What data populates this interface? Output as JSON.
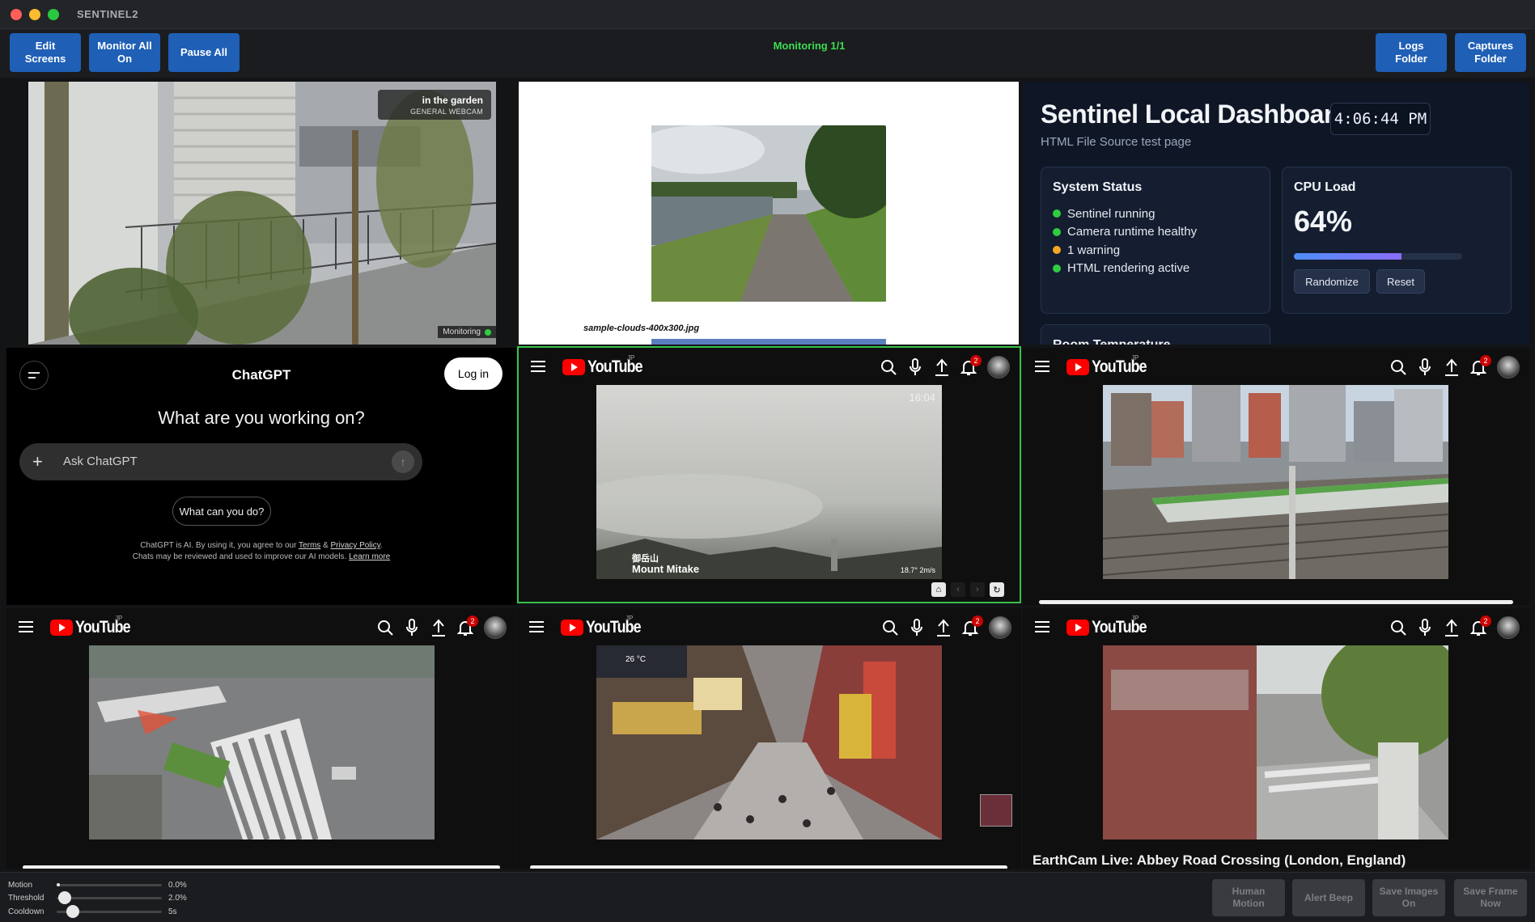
{
  "app": {
    "title": "SENTINEL2"
  },
  "toolbar": {
    "edit_screens": "Edit Screens",
    "monitor_all_on": "Monitor All On",
    "pause_all": "Pause All",
    "monitoring_status": "Monitoring 1/1",
    "logs_folder": "Logs Folder",
    "captures_folder": "Captures Folder"
  },
  "garden_cam": {
    "title": "in the garden",
    "subtitle": "GENERAL WEBCAM",
    "monitoring_tag": "Monitoring"
  },
  "html_pane": {
    "caption": "sample-clouds-400x300.jpg"
  },
  "dashboard": {
    "title": "Sentinel Local Dashboard",
    "subtitle": "HTML File Source test page",
    "clock": "4:06:44 PM",
    "system_status": {
      "title": "System Status",
      "items": [
        {
          "label": "Sentinel running",
          "color": "#2ecc40"
        },
        {
          "label": "Camera runtime healthy",
          "color": "#2ecc40"
        },
        {
          "label": "1 warning",
          "color": "#f5a623"
        },
        {
          "label": "HTML rendering active",
          "color": "#2ecc40"
        }
      ]
    },
    "cpu": {
      "title": "CPU Load",
      "value": "64%",
      "bar_fraction": 0.64,
      "randomize": "Randomize",
      "reset": "Reset"
    },
    "room_temp_title": "Room Temperature"
  },
  "chatgpt": {
    "title": "ChatGPT",
    "login": "Log in",
    "question": "What are you working on?",
    "input_placeholder": "Ask ChatGPT",
    "suggestion": "What can you do?",
    "legal_line1_a": "ChatGPT is AI. By using it, you agree to our ",
    "legal_terms": "Terms",
    "legal_amp": " & ",
    "legal_privacy": "Privacy Policy",
    "legal_line1_end": ".",
    "legal_line2": "Chats may be reviewed and used to improve our AI models. ",
    "legal_learn": "Learn more"
  },
  "youtube": {
    "logo_text": "YouTube",
    "region": "JP",
    "notification_count": "2",
    "mitake": {
      "time": "16:04",
      "name_jp": "御岳山",
      "name_en": "Mount Mitake",
      "weather": "18.7° 2m/s"
    },
    "shinjuku_weather": "26 °C",
    "abbey_title": "EarthCam Live: Abbey Road Crossing (London, England)"
  },
  "bottombar": {
    "motion": {
      "label": "Motion",
      "value": "0.0%",
      "fraction": 0.0
    },
    "threshold": {
      "label": "Threshold",
      "value": "2.0%",
      "fraction": 0.08
    },
    "cooldown": {
      "label": "Cooldown",
      "value": "5s",
      "fraction": 0.15
    },
    "human_motion": "Human Motion",
    "alert_beep": "Alert Beep",
    "save_images_on": "Save Images On",
    "save_frame_now": "Save Frame Now"
  }
}
